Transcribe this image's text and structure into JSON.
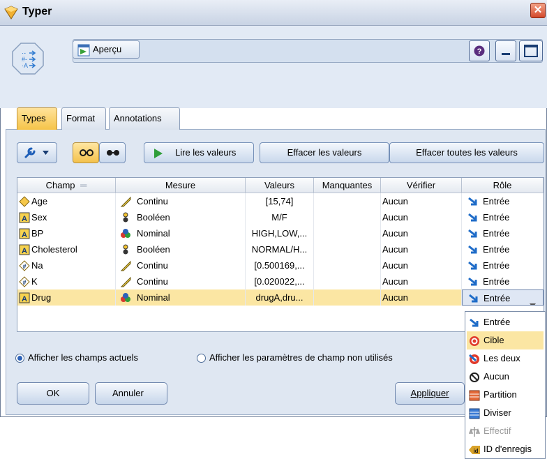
{
  "window": {
    "title": "Typer",
    "close_glyph": "✕"
  },
  "toolbar": {
    "preview_label": "Aperçu"
  },
  "tabs": [
    {
      "label": "Types"
    },
    {
      "label": "Format"
    },
    {
      "label": "Annotations"
    }
  ],
  "actions": {
    "read_values": "Lire les valeurs",
    "clear_values": "Effacer les valeurs",
    "clear_all_values": "Effacer toutes les valeurs"
  },
  "table": {
    "headers": [
      "Champ",
      "Mesure",
      "Valeurs",
      "Manquantes",
      "Vérifier",
      "Rôle"
    ],
    "rows": [
      {
        "field": "Age",
        "field_icon": "continuous-diamond-icon",
        "measure": "Continu",
        "measure_icon": "ruler-icon",
        "values": "[15,74]",
        "missing": "",
        "check": "Aucun",
        "role": "Entrée"
      },
      {
        "field": "Sex",
        "field_icon": "string-a-icon",
        "measure": "Booléen",
        "measure_icon": "flag-icon",
        "values": "M/F",
        "missing": "",
        "check": "Aucun",
        "role": "Entrée"
      },
      {
        "field": "BP",
        "field_icon": "string-a-icon",
        "measure": "Nominal",
        "measure_icon": "nominal-circles-icon",
        "values": "HIGH,LOW,...",
        "missing": "",
        "check": "Aucun",
        "role": "Entrée"
      },
      {
        "field": "Cholesterol",
        "field_icon": "string-a-icon",
        "measure": "Booléen",
        "measure_icon": "flag-icon",
        "values": "NORMAL/H...",
        "missing": "",
        "check": "Aucun",
        "role": "Entrée"
      },
      {
        "field": "Na",
        "field_icon": "numeric-hash-icon",
        "measure": "Continu",
        "measure_icon": "ruler-icon",
        "values": "[0.500169,...",
        "missing": "",
        "check": "Aucun",
        "role": "Entrée"
      },
      {
        "field": "K",
        "field_icon": "numeric-hash-icon",
        "measure": "Continu",
        "measure_icon": "ruler-icon",
        "values": "[0.020022,...",
        "missing": "",
        "check": "Aucun",
        "role": "Entrée"
      },
      {
        "field": "Drug",
        "field_icon": "string-a-icon",
        "measure": "Nominal",
        "measure_icon": "nominal-circles-icon",
        "values": "drugA,dru...",
        "missing": "",
        "check": "Aucun",
        "role": "Entrée"
      }
    ]
  },
  "options": {
    "show_current": "Afficher les champs actuels",
    "show_unused": "Afficher les paramètres de champ non utilisés"
  },
  "buttons": {
    "ok": "OK",
    "cancel": "Annuler",
    "apply": "Appliquer"
  },
  "role_dropdown": {
    "selected": "Entrée",
    "items": [
      {
        "label": "Entrée",
        "icon": "input-arrow-icon"
      },
      {
        "label": "Cible",
        "icon": "target-icon"
      },
      {
        "label": "Les deux",
        "icon": "both-icon"
      },
      {
        "label": "Aucun",
        "icon": "none-icon"
      },
      {
        "label": "Partition",
        "icon": "partition-icon"
      },
      {
        "label": "Diviser",
        "icon": "split-icon"
      },
      {
        "label": "Effectif",
        "icon": "frequency-icon"
      },
      {
        "label": "ID d'enregis",
        "icon": "record-id-icon"
      }
    ]
  },
  "colors": {
    "selected_row": "#fbe6a3",
    "highlight_item": "#fbe6a3",
    "accent_blue": "#2c62b9"
  }
}
